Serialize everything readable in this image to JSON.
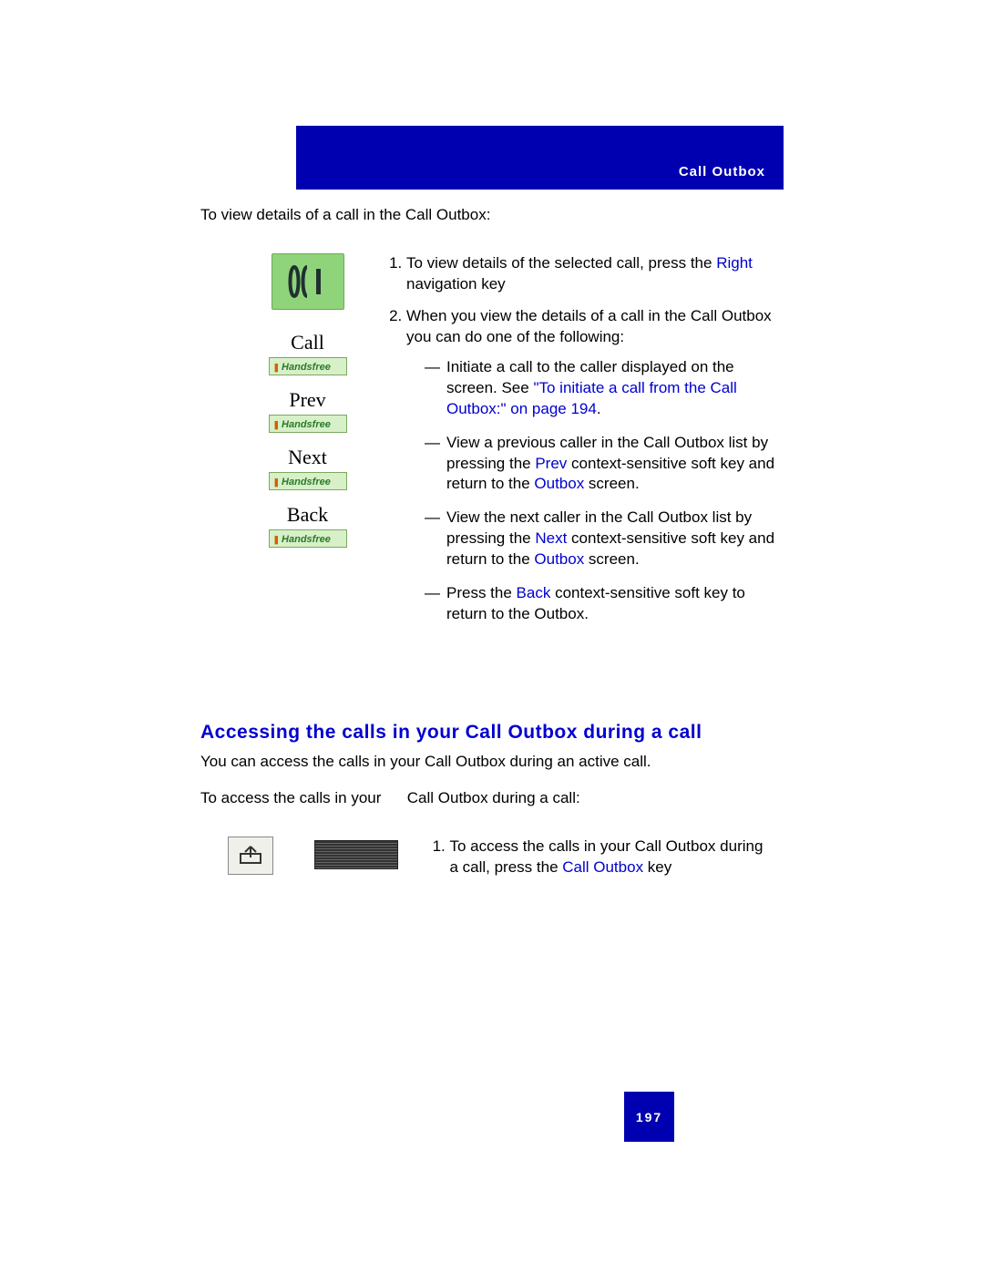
{
  "header": {
    "title": "Call Outbox"
  },
  "intro": "To view details of a call in the Call Outbox:",
  "softkeys": {
    "items": [
      "Call",
      "Prev",
      "Next",
      "Back"
    ],
    "button_label": "Handsfree"
  },
  "steps": {
    "s1_a": "To view details of the selected call, press the ",
    "s1_link": "Right",
    "s1_b": " navigation key",
    "s2": "When you view the details of a call in the Call Outbox you can do one of the following:",
    "d1_a": "Initiate a call to the caller displayed on the screen. See ",
    "d1_link": "\"To initiate a call from the Call Outbox:\" on page 194",
    "d1_b": ".",
    "d2_a": "View a previous caller in the Call Outbox list by pressing the ",
    "d2_link1": "Prev",
    "d2_b": " context-sensitive soft key and return to the ",
    "d2_link2": "Outbox",
    "d2_c": " screen.",
    "d3_a": "View the next caller in the Call Outbox list by pressing the ",
    "d3_link1": "Next",
    "d3_b": " context-sensitive soft key and return to the ",
    "d3_link2": "Outbox",
    "d3_c": " screen.",
    "d4_a": "Press the ",
    "d4_link": "Back",
    "d4_b": " context-sensitive soft key to return to the Outbox."
  },
  "section": {
    "heading": "Accessing the calls in your Call Outbox during a call",
    "p1": "You can access the calls in your Call Outbox during an active call.",
    "p2": "To access the calls in your      Call Outbox during a call:",
    "step_a": "To access the calls in your Call Outbox during a call, press the ",
    "step_link": "Call Outbox",
    "step_b": " key"
  },
  "page_number": "197"
}
